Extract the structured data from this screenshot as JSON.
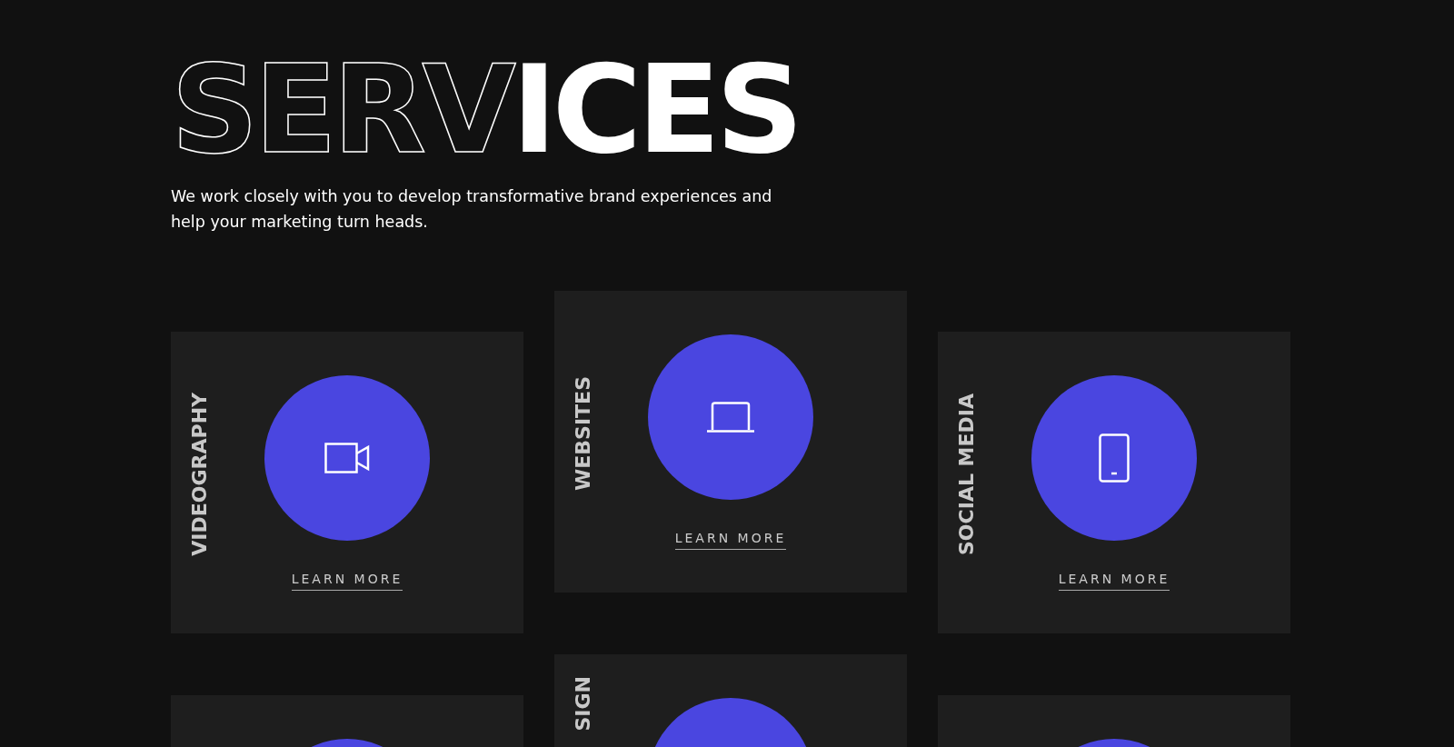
{
  "heading": {
    "parts": [
      {
        "text": "SERV",
        "kind": "outline"
      },
      {
        "text": "ICES",
        "kind": "solid"
      }
    ]
  },
  "intro": "We work closely with you to develop transformative brand experiences and help your marketing turn heads.",
  "cards": [
    {
      "kind": "full",
      "label": "VIDEOGRAPHY",
      "link": "LEARN MORE"
    },
    {
      "kind": "full",
      "label": "WEBSITES",
      "link": "LEARN MORE"
    },
    {
      "kind": "full",
      "label": "SOCIAL MEDIA",
      "link": "LEARN MORE"
    },
    {
      "kind": "partial"
    },
    {
      "kind": "partial",
      "label": "SIGN"
    },
    {
      "kind": "partial"
    }
  ]
}
